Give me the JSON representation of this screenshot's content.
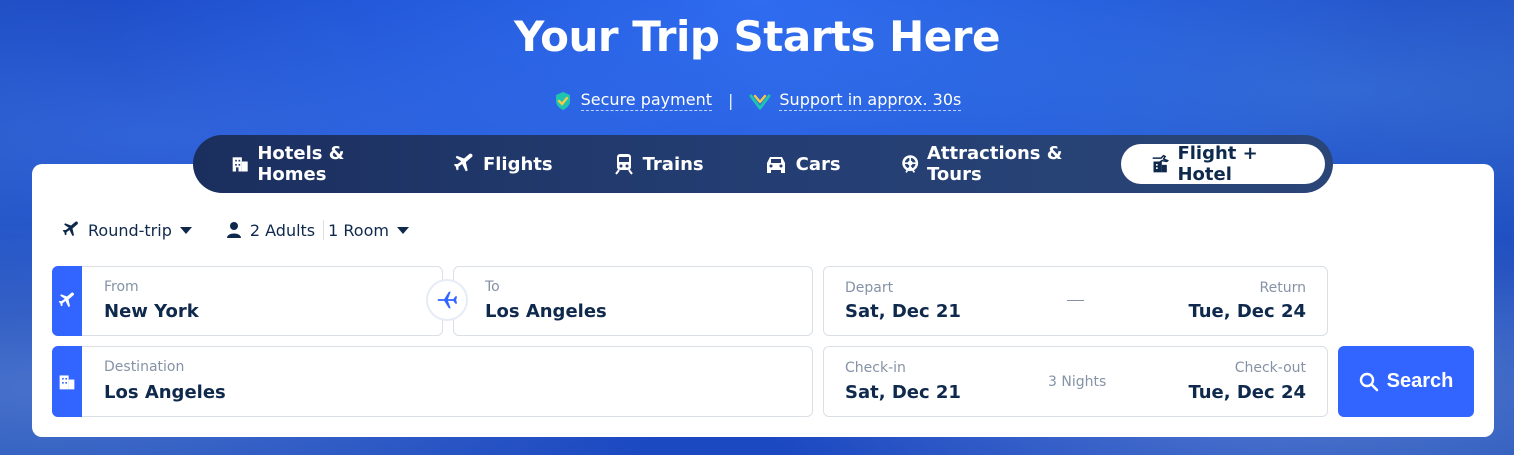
{
  "hero": {
    "title": "Your Trip Starts Here",
    "badges": [
      {
        "icon": "shield-check-icon",
        "label": "Secure payment"
      },
      {
        "icon": "support-check-icon",
        "label": "Support in approx. 30s"
      }
    ],
    "separator": "|"
  },
  "tabs": [
    {
      "icon": "hotel-icon",
      "label": "Hotels & Homes"
    },
    {
      "icon": "plane-icon",
      "label": "Flights"
    },
    {
      "icon": "train-icon",
      "label": "Trains"
    },
    {
      "icon": "car-icon",
      "label": "Cars"
    },
    {
      "icon": "attraction-icon",
      "label": "Attractions & Tours"
    },
    {
      "icon": "flight-hotel-icon",
      "label": "Flight + Hotel",
      "active": true
    }
  ],
  "options": {
    "trip_type": "Round-trip",
    "adults": "2 Adults",
    "rooms": "1 Room"
  },
  "flight": {
    "from_label": "From",
    "from_value": "New York",
    "to_label": "To",
    "to_value": "Los Angeles",
    "depart_label": "Depart",
    "depart_value": "Sat, Dec 21",
    "return_label": "Return",
    "return_value": "Tue, Dec 24"
  },
  "hotel": {
    "destination_label": "Destination",
    "destination_value": "Los Angeles",
    "checkin_label": "Check-in",
    "checkin_value": "Sat, Dec 21",
    "nights": "3 Nights",
    "checkout_label": "Check-out",
    "checkout_value": "Tue, Dec 24"
  },
  "search_label": "Search",
  "colors": {
    "accent": "#3264ff",
    "text": "#0f294d",
    "muted": "#8592a6"
  }
}
